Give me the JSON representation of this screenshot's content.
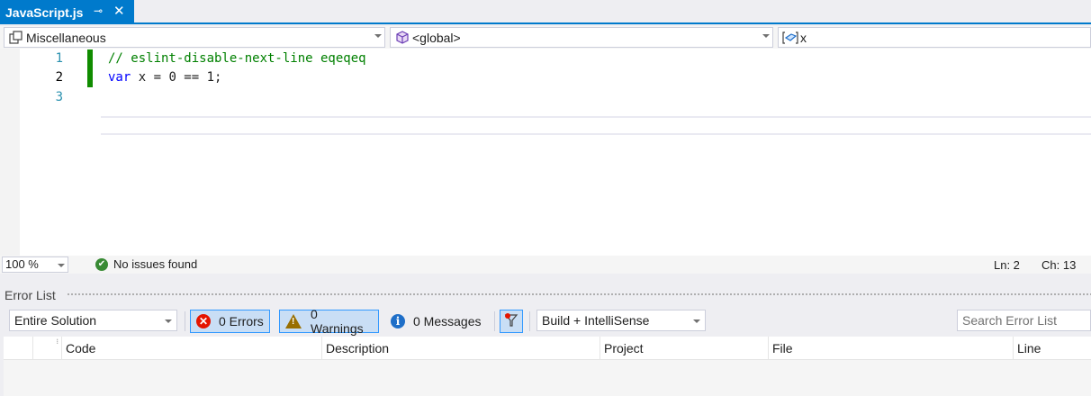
{
  "tab": {
    "title": "JavaScript.js",
    "pin_glyph": "⊸",
    "close_glyph": "✕"
  },
  "navbar": {
    "project": "Miscellaneous",
    "scope": "<global>",
    "member": "x",
    "icons": [
      "project-icon",
      "namespace-cube-icon",
      "variable-icon"
    ]
  },
  "editor": {
    "lines": [
      {
        "number": "1",
        "text": "// eslint-disable-next-line eqeqeq"
      },
      {
        "number": "2",
        "keyword": "var",
        "rest": " x = 0 == 1;"
      },
      {
        "number": "3",
        "text": ""
      }
    ],
    "colors": {
      "comment": "#008000",
      "keyword": "#0000ff",
      "line_number": "#2b91af",
      "change_bar": "#108c00"
    }
  },
  "status": {
    "zoom": "100 %",
    "issues": "No issues found",
    "ln": "Ln: 2",
    "ch": "Ch: 13"
  },
  "errorlist": {
    "title": "Error List",
    "scope": "Entire Solution",
    "errors": "0 Errors",
    "warnings": "0 Warnings",
    "messages": "0 Messages",
    "build_filter": "Build + IntelliSense",
    "search_placeholder": "Search Error List",
    "columns": [
      "Code",
      "Description",
      "Project",
      "File",
      "Line"
    ]
  }
}
